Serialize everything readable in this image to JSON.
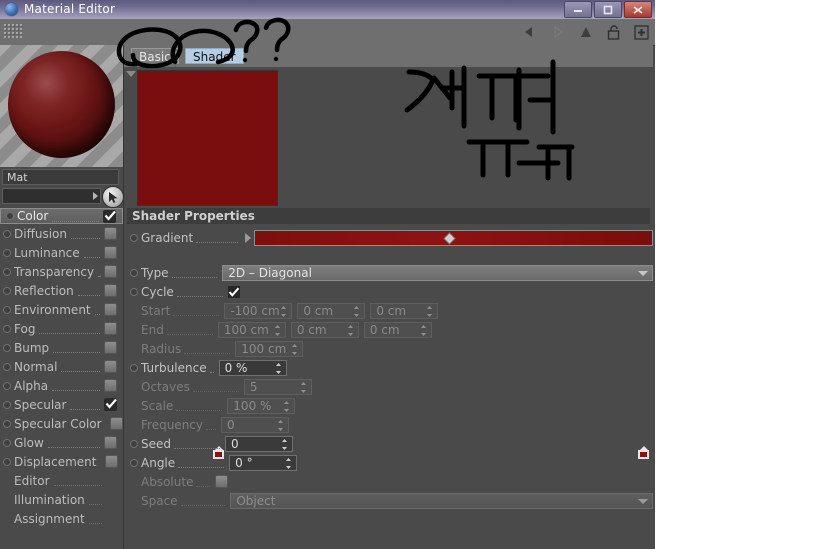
{
  "window": {
    "title": "Material Editor",
    "icon": "sphere-app-icon",
    "buttons": [
      {
        "name": "minimize",
        "glyph": "—"
      },
      {
        "name": "maximize",
        "glyph": "❐"
      },
      {
        "name": "close",
        "glyph": "✕"
      }
    ]
  },
  "toolbar": {
    "grip": "drag-grip",
    "icons": [
      {
        "name": "back-arrow-icon",
        "glyph": "◀"
      },
      {
        "name": "forward-arrow-icon",
        "glyph": "▶"
      },
      {
        "name": "up-arrow-icon",
        "glyph": "▲"
      },
      {
        "name": "lock-open-icon",
        "glyph": "🔓"
      },
      {
        "name": "add-icon",
        "glyph": "✚"
      }
    ]
  },
  "material": {
    "preview_label": "material-preview-sphere",
    "name": "Mat",
    "link_value": "",
    "pick_icon": "cursor-arrow-icon"
  },
  "channels": [
    {
      "label": "Color",
      "checked": true,
      "selected": true,
      "has_dot": true
    },
    {
      "label": "Diffusion",
      "checked": false,
      "selected": false,
      "has_dot": true
    },
    {
      "label": "Luminance",
      "checked": false,
      "selected": false,
      "has_dot": true
    },
    {
      "label": "Transparency",
      "checked": false,
      "selected": false,
      "has_dot": true
    },
    {
      "label": "Reflection",
      "checked": false,
      "selected": false,
      "has_dot": true
    },
    {
      "label": "Environment",
      "checked": false,
      "selected": false,
      "has_dot": true
    },
    {
      "label": "Fog",
      "checked": false,
      "selected": false,
      "has_dot": true
    },
    {
      "label": "Bump",
      "checked": false,
      "selected": false,
      "has_dot": true
    },
    {
      "label": "Normal",
      "checked": false,
      "selected": false,
      "has_dot": true
    },
    {
      "label": "Alpha",
      "checked": false,
      "selected": false,
      "has_dot": true
    },
    {
      "label": "Specular",
      "checked": true,
      "selected": false,
      "has_dot": true
    },
    {
      "label": "Specular Color",
      "checked": false,
      "selected": false,
      "has_dot": true
    },
    {
      "label": "Glow",
      "checked": false,
      "selected": false,
      "has_dot": true
    },
    {
      "label": "Displacement",
      "checked": false,
      "selected": false,
      "has_dot": true
    },
    {
      "label": "Editor",
      "checked": null,
      "selected": false,
      "has_dot": false
    },
    {
      "label": "Illumination",
      "checked": null,
      "selected": false,
      "has_dot": false
    },
    {
      "label": "Assignment",
      "checked": null,
      "selected": false,
      "has_dot": false
    }
  ],
  "tabs": [
    {
      "label": "Basic",
      "active": false
    },
    {
      "label": "Shader",
      "active": true
    }
  ],
  "swatch_color": "#7a0d0d",
  "section": {
    "title": "Shader Properties",
    "gradient": {
      "label": "Gradient",
      "colors": [
        "#7d0f0f",
        "#8f1212",
        "#7a0d0d"
      ]
    },
    "type": {
      "label": "Type",
      "value": "2D – Diagonal"
    },
    "cycle": {
      "label": "Cycle",
      "checked": true
    },
    "start": {
      "label": "Start",
      "values": [
        "-100 cm",
        "0 cm",
        "0 cm"
      ],
      "enabled": false
    },
    "end": {
      "label": "End",
      "values": [
        "100 cm",
        "0 cm",
        "0 cm"
      ],
      "enabled": false
    },
    "radius": {
      "label": "Radius",
      "value": "100 cm",
      "enabled": false
    },
    "turbulence": {
      "label": "Turbulence",
      "value": "0 %",
      "enabled": true
    },
    "octaves": {
      "label": "Octaves",
      "value": "5",
      "enabled": false
    },
    "scale": {
      "label": "Scale",
      "value": "100 %",
      "enabled": false
    },
    "frequency": {
      "label": "Frequency",
      "value": "0",
      "enabled": false
    },
    "seed": {
      "label": "Seed",
      "value": "0",
      "enabled": true
    },
    "angle": {
      "label": "Angle",
      "value": "0 °",
      "enabled": true
    },
    "absolute": {
      "label": "Absolute",
      "checked": false,
      "enabled": false
    },
    "space": {
      "label": "Space",
      "value": "Object",
      "enabled": false
    }
  },
  "annotations": {
    "korean_note": "제꺼",
    "emoticon": "ㅠ_ㅠ",
    "question_marks": "??",
    "circles": [
      "circle-around-basic-tab",
      "circle-around-shader-tab"
    ],
    "ink_color": "#000000"
  }
}
